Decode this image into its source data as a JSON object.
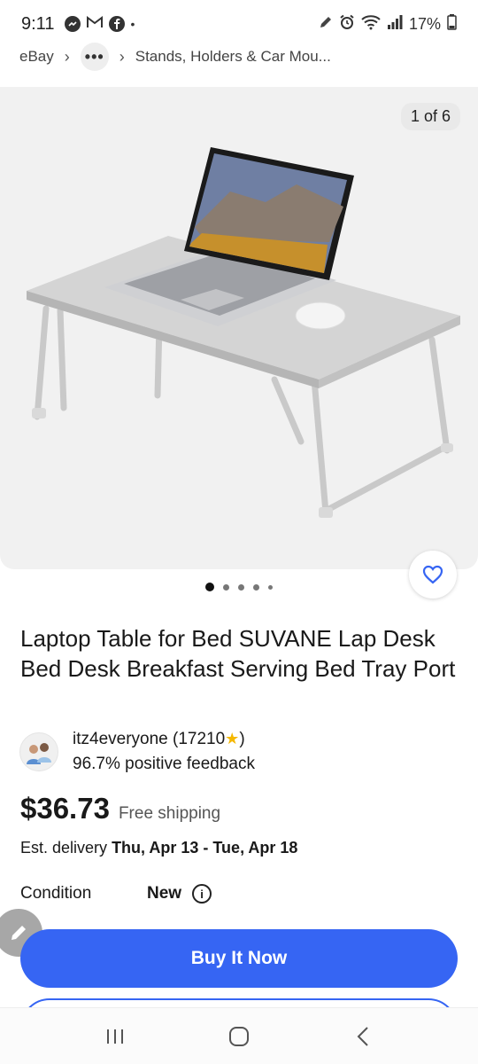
{
  "status_bar": {
    "time": "9:11",
    "dot": "•",
    "battery": "17%",
    "icons": [
      "messenger-icon",
      "gmail-icon",
      "facebook-icon",
      "edit-pencil-icon",
      "alarm-icon",
      "wifi-icon",
      "signal-icon",
      "battery-icon"
    ]
  },
  "breadcrumb": {
    "root": "eBay",
    "more": "•••",
    "category": "Stands, Holders & Car Mou..."
  },
  "gallery": {
    "counter": "1 of 6",
    "dots_count": 5,
    "active_index": 0
  },
  "listing": {
    "title": "Laptop Table for Bed SUVANE Lap Desk Bed Desk Breakfast Serving Bed Tray Port",
    "seller_name": "itz4everyone (17210",
    "seller_name_suffix": ")",
    "seller_feedback": "96.7% positive feedback",
    "price": "$36.73",
    "shipping": "Free shipping",
    "delivery_label": "Est. delivery",
    "delivery_dates": "Thu, Apr 13 - Tue, Apr 18",
    "condition_label": "Condition",
    "condition_value": "New"
  },
  "actions": {
    "buy_now": "Buy It Now"
  },
  "colors": {
    "accent": "#3665f3",
    "star": "#f5b800"
  }
}
